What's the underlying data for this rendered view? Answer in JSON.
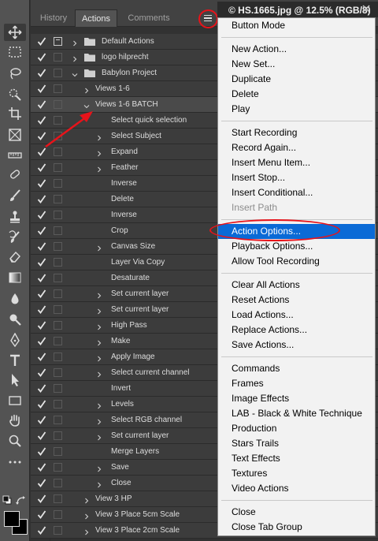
{
  "document_title": "© HS.1665.jpg @ 12.5% (RGB/8)",
  "tabs": [
    {
      "label": "History",
      "active": false
    },
    {
      "label": "Actions",
      "active": true
    },
    {
      "label": "Comments",
      "active": false
    }
  ],
  "actions": [
    {
      "label": "Default Actions",
      "level": 0,
      "type": "set",
      "expand": "collapsed",
      "dialog": true
    },
    {
      "label": "logo hilprecht",
      "level": 0,
      "type": "set",
      "expand": "collapsed",
      "dialog": false
    },
    {
      "label": "Babylon Project",
      "level": 0,
      "type": "set",
      "expand": "expanded",
      "dialog": false
    },
    {
      "label": "Views 1-6",
      "level": 1,
      "type": "action",
      "expand": "collapsed",
      "dialog": false
    },
    {
      "label": "Views 1-6 BATCH",
      "level": 1,
      "type": "action",
      "expand": "expanded",
      "dialog": false,
      "selected": true
    },
    {
      "label": "Select quick selection",
      "level": 2,
      "type": "step",
      "expand": "none",
      "dialog": false
    },
    {
      "label": "Select Subject",
      "level": 2,
      "type": "step",
      "expand": "collapsed",
      "dialog": false
    },
    {
      "label": "Expand",
      "level": 2,
      "type": "step",
      "expand": "collapsed",
      "dialog": false
    },
    {
      "label": "Feather",
      "level": 2,
      "type": "step",
      "expand": "collapsed",
      "dialog": false
    },
    {
      "label": "Inverse",
      "level": 2,
      "type": "step",
      "expand": "none",
      "dialog": false
    },
    {
      "label": "Delete",
      "level": 2,
      "type": "step",
      "expand": "none",
      "dialog": false
    },
    {
      "label": "Inverse",
      "level": 2,
      "type": "step",
      "expand": "none",
      "dialog": false
    },
    {
      "label": "Crop",
      "level": 2,
      "type": "step",
      "expand": "none",
      "dialog": false
    },
    {
      "label": "Canvas Size",
      "level": 2,
      "type": "step",
      "expand": "collapsed",
      "dialog": false
    },
    {
      "label": "Layer Via Copy",
      "level": 2,
      "type": "step",
      "expand": "none",
      "dialog": false
    },
    {
      "label": "Desaturate",
      "level": 2,
      "type": "step",
      "expand": "none",
      "dialog": false
    },
    {
      "label": "Set current layer",
      "level": 2,
      "type": "step",
      "expand": "collapsed",
      "dialog": false
    },
    {
      "label": "Set current layer",
      "level": 2,
      "type": "step",
      "expand": "collapsed",
      "dialog": false
    },
    {
      "label": "High Pass",
      "level": 2,
      "type": "step",
      "expand": "collapsed",
      "dialog": false
    },
    {
      "label": "Make",
      "level": 2,
      "type": "step",
      "expand": "collapsed",
      "dialog": false
    },
    {
      "label": "Apply Image",
      "level": 2,
      "type": "step",
      "expand": "collapsed",
      "dialog": false
    },
    {
      "label": "Select current channel",
      "level": 2,
      "type": "step",
      "expand": "collapsed",
      "dialog": false
    },
    {
      "label": "Invert",
      "level": 2,
      "type": "step",
      "expand": "none",
      "dialog": false
    },
    {
      "label": "Levels",
      "level": 2,
      "type": "step",
      "expand": "collapsed",
      "dialog": false
    },
    {
      "label": "Select RGB channel",
      "level": 2,
      "type": "step",
      "expand": "collapsed",
      "dialog": false
    },
    {
      "label": "Set current layer",
      "level": 2,
      "type": "step",
      "expand": "collapsed",
      "dialog": false
    },
    {
      "label": "Merge Layers",
      "level": 2,
      "type": "step",
      "expand": "none",
      "dialog": false
    },
    {
      "label": "Save",
      "level": 2,
      "type": "step",
      "expand": "collapsed",
      "dialog": false
    },
    {
      "label": "Close",
      "level": 2,
      "type": "step",
      "expand": "collapsed",
      "dialog": false
    },
    {
      "label": "View 3 HP",
      "level": 1,
      "type": "action",
      "expand": "collapsed",
      "dialog": false
    },
    {
      "label": "View 3 Place 5cm Scale",
      "level": 1,
      "type": "action",
      "expand": "collapsed",
      "dialog": false
    },
    {
      "label": "View 3 Place 2cm Scale",
      "level": 1,
      "type": "action",
      "expand": "collapsed",
      "dialog": false
    }
  ],
  "menu_groups": [
    [
      "Button Mode"
    ],
    [
      "New Action...",
      "New Set...",
      "Duplicate",
      "Delete",
      "Play"
    ],
    [
      "Start Recording",
      "Record Again...",
      "Insert Menu Item...",
      "Insert Stop...",
      "Insert Conditional...",
      "Insert Path"
    ],
    [
      "Action Options...",
      "Playback Options...",
      "Allow Tool Recording"
    ],
    [
      "Clear All Actions",
      "Reset Actions",
      "Load Actions...",
      "Replace Actions...",
      "Save Actions..."
    ],
    [
      "Commands",
      "Frames",
      "Image Effects",
      "LAB - Black & White Technique",
      "Production",
      "Stars Trails",
      "Text Effects",
      "Textures",
      "Video Actions"
    ],
    [
      "Close",
      "Close Tab Group"
    ]
  ],
  "menu_disabled": [
    "Insert Path"
  ],
  "menu_highlighted": "Action Options...",
  "tools": [
    "move-icon",
    "marquee-icon",
    "lasso-icon",
    "quick-selection-icon",
    "crop-icon",
    "frame-icon",
    "ruler-icon",
    "healing-brush-icon",
    "brush-icon",
    "stamp-icon",
    "history-brush-icon",
    "eraser-icon",
    "gradient-icon",
    "blur-icon",
    "dodge-icon",
    "pen-icon",
    "type-icon",
    "path-selection-icon",
    "rectangle-icon",
    "hand-icon",
    "zoom-icon",
    "more-tools-icon"
  ],
  "colors": {
    "annotation_red": "#e8131a",
    "menu_highlight": "#0a6ad6",
    "panel_bg": "#3c3c3c",
    "toolbar_bg": "#535353"
  }
}
